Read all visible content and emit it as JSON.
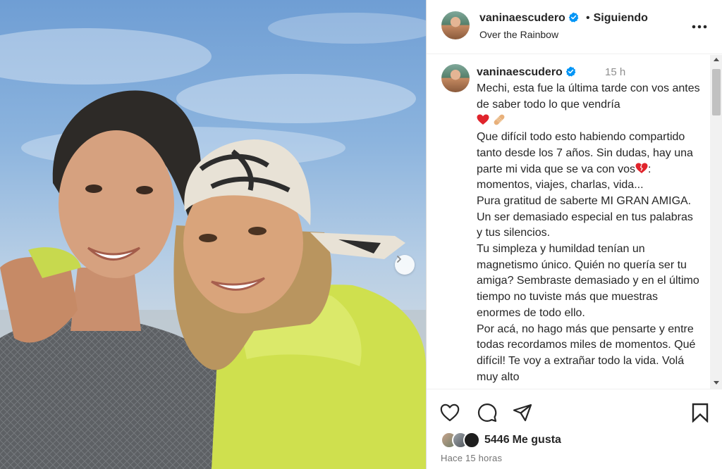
{
  "post": {
    "username": "vaninaescudero",
    "follow_separator": "•",
    "follow_status": "Siguiendo",
    "audio": "Over the Rainbow"
  },
  "caption": {
    "username": "vaninaescudero",
    "time_ago": "15 h",
    "lines": [
      "Mechi, esta fue la última tarde con vos antes de saber todo lo que vendría",
      "Que difícil todo esto habiendo compartido tanto desde los 7 años. Sin dudas, hay una parte mi vida que se va con vos",
      ": momentos, viajes, charlas, vida...",
      "Pura gratitud de saberte MI GRAN AMIGA. Un ser demasiado especial en tus palabras y tus silencios.",
      "Tu simpleza y humildad tenían un magnetismo único. Quién no quería ser tu amiga? Sembraste demasiado y en el último tiempo no tuviste más que muestras enormes de todo ello.",
      "Por acá, no hago más que pensarte y entre todas recordamos miles de momentos. Qué difícil! Te voy a extrañar todo la vida. Volá muy alto"
    ]
  },
  "engagement": {
    "likes_count": "5446",
    "likes_label": "Me gusta",
    "posted": "Hace 15 horas"
  },
  "icons": {
    "verified": "verified-badge-icon",
    "more": "more-options-icon",
    "like": "heart-outline-icon",
    "comment": "comment-bubble-icon",
    "share": "paper-plane-icon",
    "save": "bookmark-icon",
    "next": "chevron-right-icon"
  },
  "colors": {
    "verified": "#0095f6",
    "heart_emoji": "#e0242c",
    "text": "#262626",
    "muted": "#8e8e8e"
  }
}
